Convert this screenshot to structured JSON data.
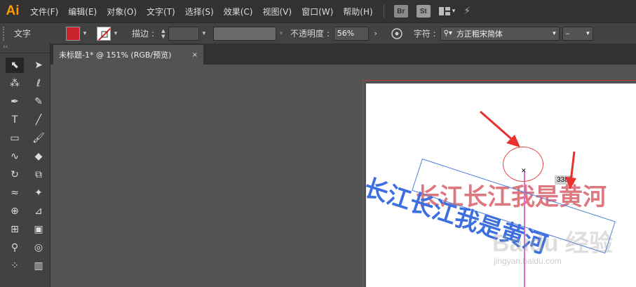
{
  "app": {
    "logo": "Ai"
  },
  "menu": [
    "文件(F)",
    "编辑(E)",
    "对象(O)",
    "文字(T)",
    "选择(S)",
    "效果(C)",
    "视图(V)",
    "窗口(W)",
    "帮助(H)"
  ],
  "menu_icons": {
    "br": "Br",
    "st": "St"
  },
  "control_bar": {
    "tool_label": "文字",
    "fill_color": "#c8232c",
    "stroke_label": "描边 :",
    "opacity_label": "不透明度 :",
    "opacity_value": "56%",
    "font_label": "字符 :",
    "font_value": "方正粗宋简体",
    "font_style_value": "–"
  },
  "toolbar": {
    "collapse": "‹‹",
    "tools": [
      {
        "name": "selection-tool-icon",
        "glyph": "⬉",
        "active": true
      },
      {
        "name": "direct-selection-tool-icon",
        "glyph": "➤"
      },
      {
        "name": "magic-wand-tool-icon",
        "glyph": "⁂"
      },
      {
        "name": "lasso-tool-icon",
        "glyph": "ℓ"
      },
      {
        "name": "pen-tool-icon",
        "glyph": "✒"
      },
      {
        "name": "curvature-tool-icon",
        "glyph": "✎"
      },
      {
        "name": "type-tool-icon",
        "glyph": "T"
      },
      {
        "name": "line-tool-icon",
        "glyph": "╱"
      },
      {
        "name": "rectangle-tool-icon",
        "glyph": "▭"
      },
      {
        "name": "paintbrush-tool-icon",
        "glyph": "🖌"
      },
      {
        "name": "shaper-tool-icon",
        "glyph": "∿"
      },
      {
        "name": "eraser-tool-icon",
        "glyph": "◆"
      },
      {
        "name": "rotate-tool-icon",
        "glyph": "↻"
      },
      {
        "name": "scale-tool-icon",
        "glyph": "⧉"
      },
      {
        "name": "width-tool-icon",
        "glyph": "≈"
      },
      {
        "name": "puppet-warp-tool-icon",
        "glyph": "✦"
      },
      {
        "name": "shape-builder-tool-icon",
        "glyph": "⊕"
      },
      {
        "name": "perspective-grid-tool-icon",
        "glyph": "⊿"
      },
      {
        "name": "mesh-tool-icon",
        "glyph": "⊞"
      },
      {
        "name": "gradient-tool-icon",
        "glyph": "▣"
      },
      {
        "name": "eyedropper-tool-icon",
        "glyph": "⚲"
      },
      {
        "name": "blend-tool-icon",
        "glyph": "◎"
      },
      {
        "name": "symbol-sprayer-tool-icon",
        "glyph": "⁘"
      },
      {
        "name": "column-graph-tool-icon",
        "glyph": "▥"
      }
    ]
  },
  "document": {
    "tab_title": "未标题-1* @ 151% (RGB/预览)",
    "tab_close": "×"
  },
  "artboard": {
    "red_text": "长江长江我是黄河",
    "blue_text": "长江长江我是黄河",
    "rotation_readout": "338°",
    "watermark": "Baidu 经验",
    "watermark_url": "jingyan.baidu.com"
  }
}
